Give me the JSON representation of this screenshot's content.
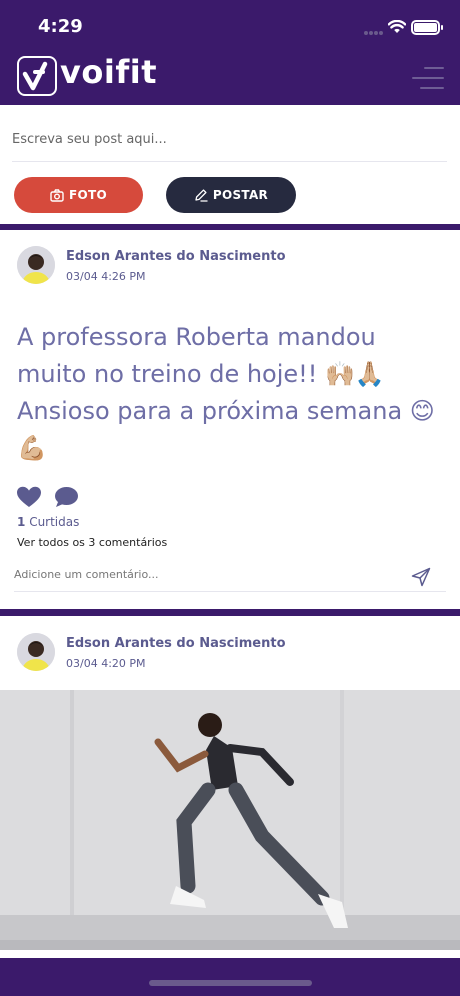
{
  "status_bar": {
    "time": "4:29"
  },
  "header": {
    "logo_text": "voifit",
    "menu_icon": "hamburger-icon"
  },
  "composer": {
    "placeholder": "Escreva seu post aqui...",
    "photo_button": "FOTO",
    "photo_icon": "camera-icon",
    "post_button": "POSTAR",
    "post_icon": "pencil-icon"
  },
  "posts": [
    {
      "author": "Edson Arantes do Nascimento",
      "time": "03/04 4:26 PM",
      "text": "A professora Roberta mandou muito no treino de hoje!! 🙌🏼🙏🏼 Ansioso para a próxima semana 😊💪🏼",
      "likes_count": "1",
      "likes_label": "Curtidas",
      "view_comments": "Ver todos os 3 comentários",
      "comment_placeholder": "Adicione um comentário..."
    },
    {
      "author": "Edson Arantes do Nascimento",
      "time": "03/04 4:20 PM"
    }
  ],
  "colors": {
    "brand_purple": "#3b1a6b",
    "photo_button": "#d64a3c",
    "post_button": "#262a3f",
    "text_purple": "#5b5b8f"
  }
}
